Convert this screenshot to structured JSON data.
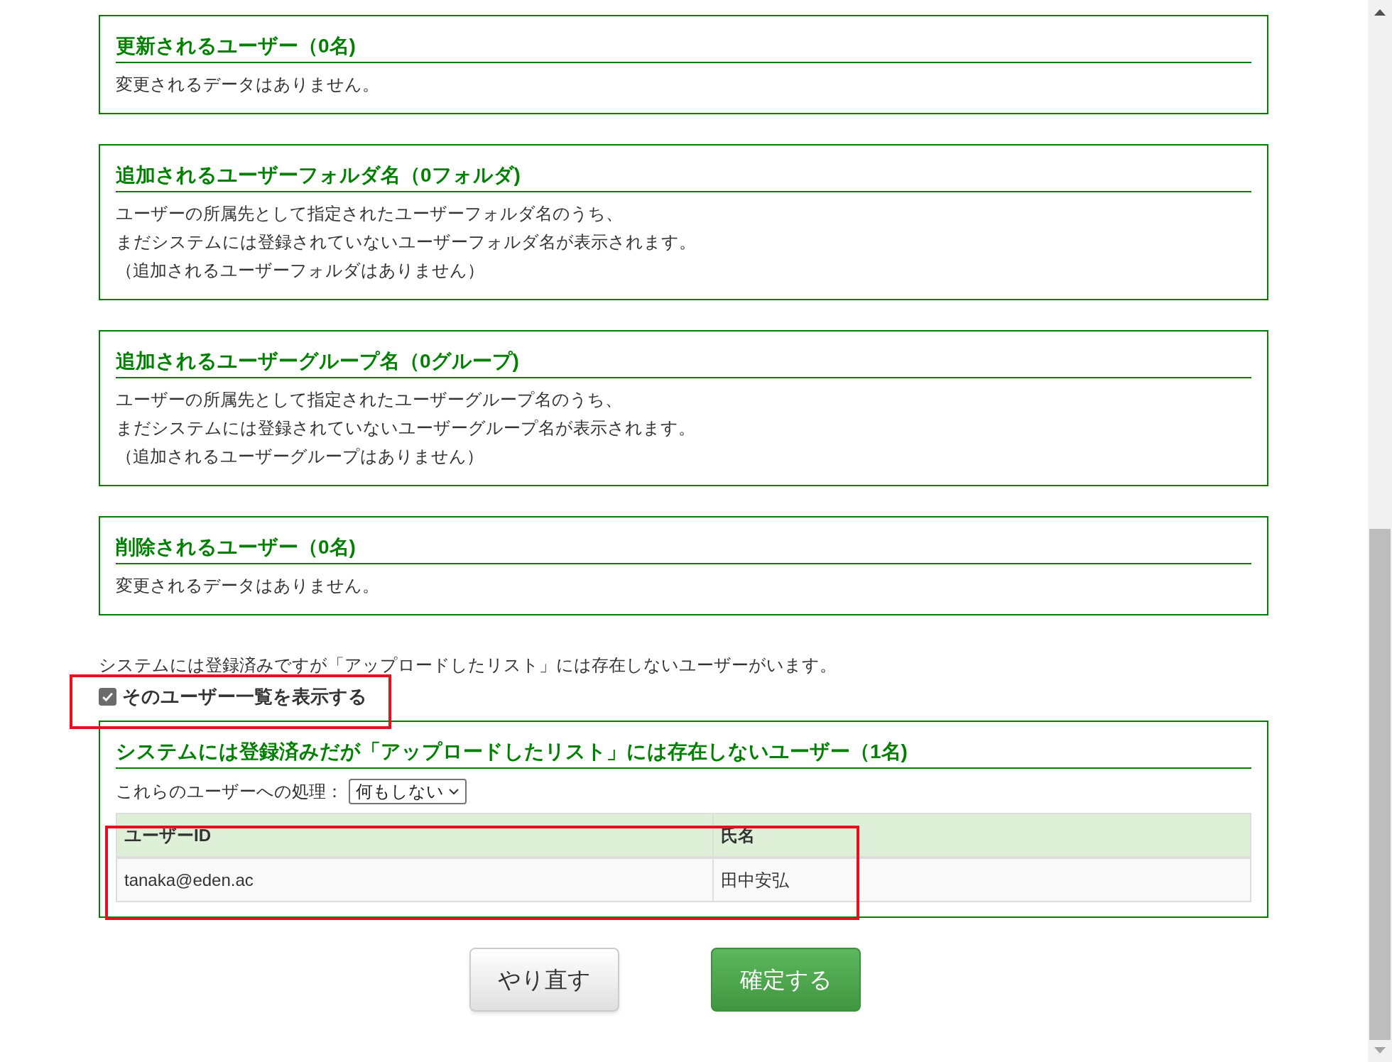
{
  "sections": [
    {
      "title": "更新されるユーザー（0名)",
      "lines": [
        "変更されるデータはありません。"
      ]
    },
    {
      "title": "追加されるユーザーフォルダ名（0フォルダ)",
      "lines": [
        "ユーザーの所属先として指定されたユーザーフォルダ名のうち、",
        "まだシステムには登録されていないユーザーフォルダ名が表示されます。",
        "（追加されるユーザーフォルダはありません）"
      ]
    },
    {
      "title": "追加されるユーザーグループ名（0グループ)",
      "lines": [
        "ユーザーの所属先として指定されたユーザーグループ名のうち、",
        "まだシステムには登録されていないユーザーグループ名が表示されます。",
        "（追加されるユーザーグループはありません）"
      ]
    },
    {
      "title": "削除されるユーザー（0名)",
      "lines": [
        "変更されるデータはありません。"
      ]
    }
  ],
  "notice": "システムには登録済みですが「アップロードしたリスト」には存在しないユーザーがいます。",
  "show_list_checkbox": {
    "label": "そのユーザー一覧を表示する",
    "checked": true
  },
  "missing_users": {
    "title": "システムには登録済みだが「アップロードしたリスト」には存在しないユーザー（1名)",
    "action_label": "これらのユーザーへの処理：",
    "action_select": {
      "value": "何もしない"
    },
    "table": {
      "columns": [
        "ユーザーID",
        "氏名"
      ],
      "rows": [
        [
          "tanaka@eden.ac",
          "田中安弘"
        ]
      ]
    }
  },
  "buttons": [
    {
      "label": "やり直す",
      "kind": "secondary"
    },
    {
      "label": "確定する",
      "kind": "primary"
    }
  ]
}
